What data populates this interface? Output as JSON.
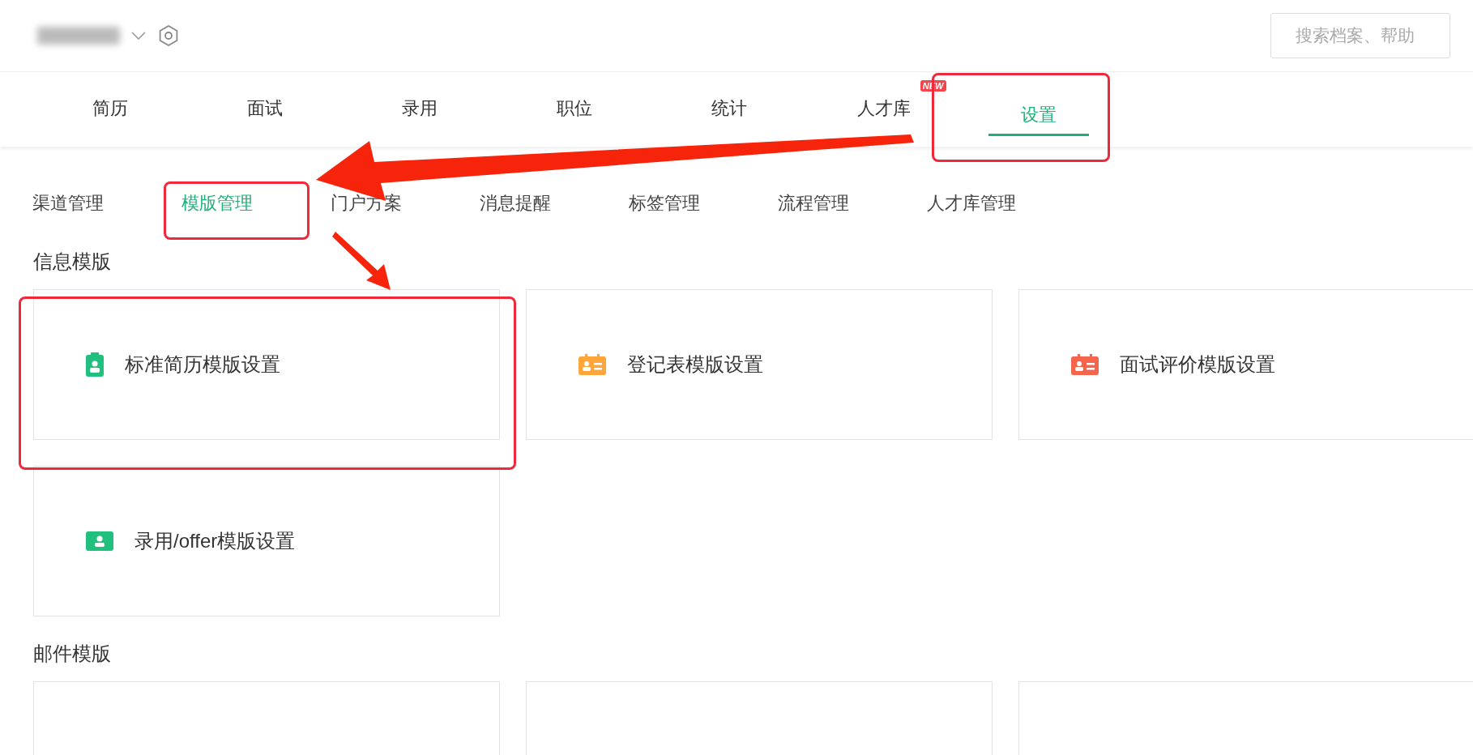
{
  "header": {
    "search": {
      "placeholder": "搜索档案、帮助"
    }
  },
  "nav_tabs": [
    {
      "label": "简历",
      "selected": false
    },
    {
      "label": "面试",
      "selected": false
    },
    {
      "label": "录用",
      "selected": false
    },
    {
      "label": "职位",
      "selected": false
    },
    {
      "label": "统计",
      "selected": false
    },
    {
      "label": "人才库",
      "selected": false,
      "badge": "NEW"
    },
    {
      "label": "设置",
      "selected": true
    }
  ],
  "sub_tabs": [
    {
      "label": "渠道管理",
      "selected": false
    },
    {
      "label": "模版管理",
      "selected": true
    },
    {
      "label": "门户方案",
      "selected": false
    },
    {
      "label": "消息提醒",
      "selected": false
    },
    {
      "label": "标签管理",
      "selected": false
    },
    {
      "label": "流程管理",
      "selected": false
    },
    {
      "label": "人才库管理",
      "selected": false
    }
  ],
  "sections": [
    {
      "title": "信息模版",
      "cards": [
        {
          "kind": "clipboard",
          "label": "标准简历模版设置",
          "color": "#22c07f"
        },
        {
          "kind": "card",
          "label": "登记表模版设置",
          "color": "#ffa53a"
        },
        {
          "kind": "card",
          "label": "面试评价模版设置",
          "color": "#f5654c"
        },
        {
          "kind": "badge",
          "label": "录用/offer模版设置",
          "color": "#22c07f"
        }
      ]
    },
    {
      "title": "邮件模版",
      "cards": [
        {
          "kind": "blank"
        },
        {
          "kind": "blank"
        },
        {
          "kind": "blank"
        }
      ]
    }
  ]
}
